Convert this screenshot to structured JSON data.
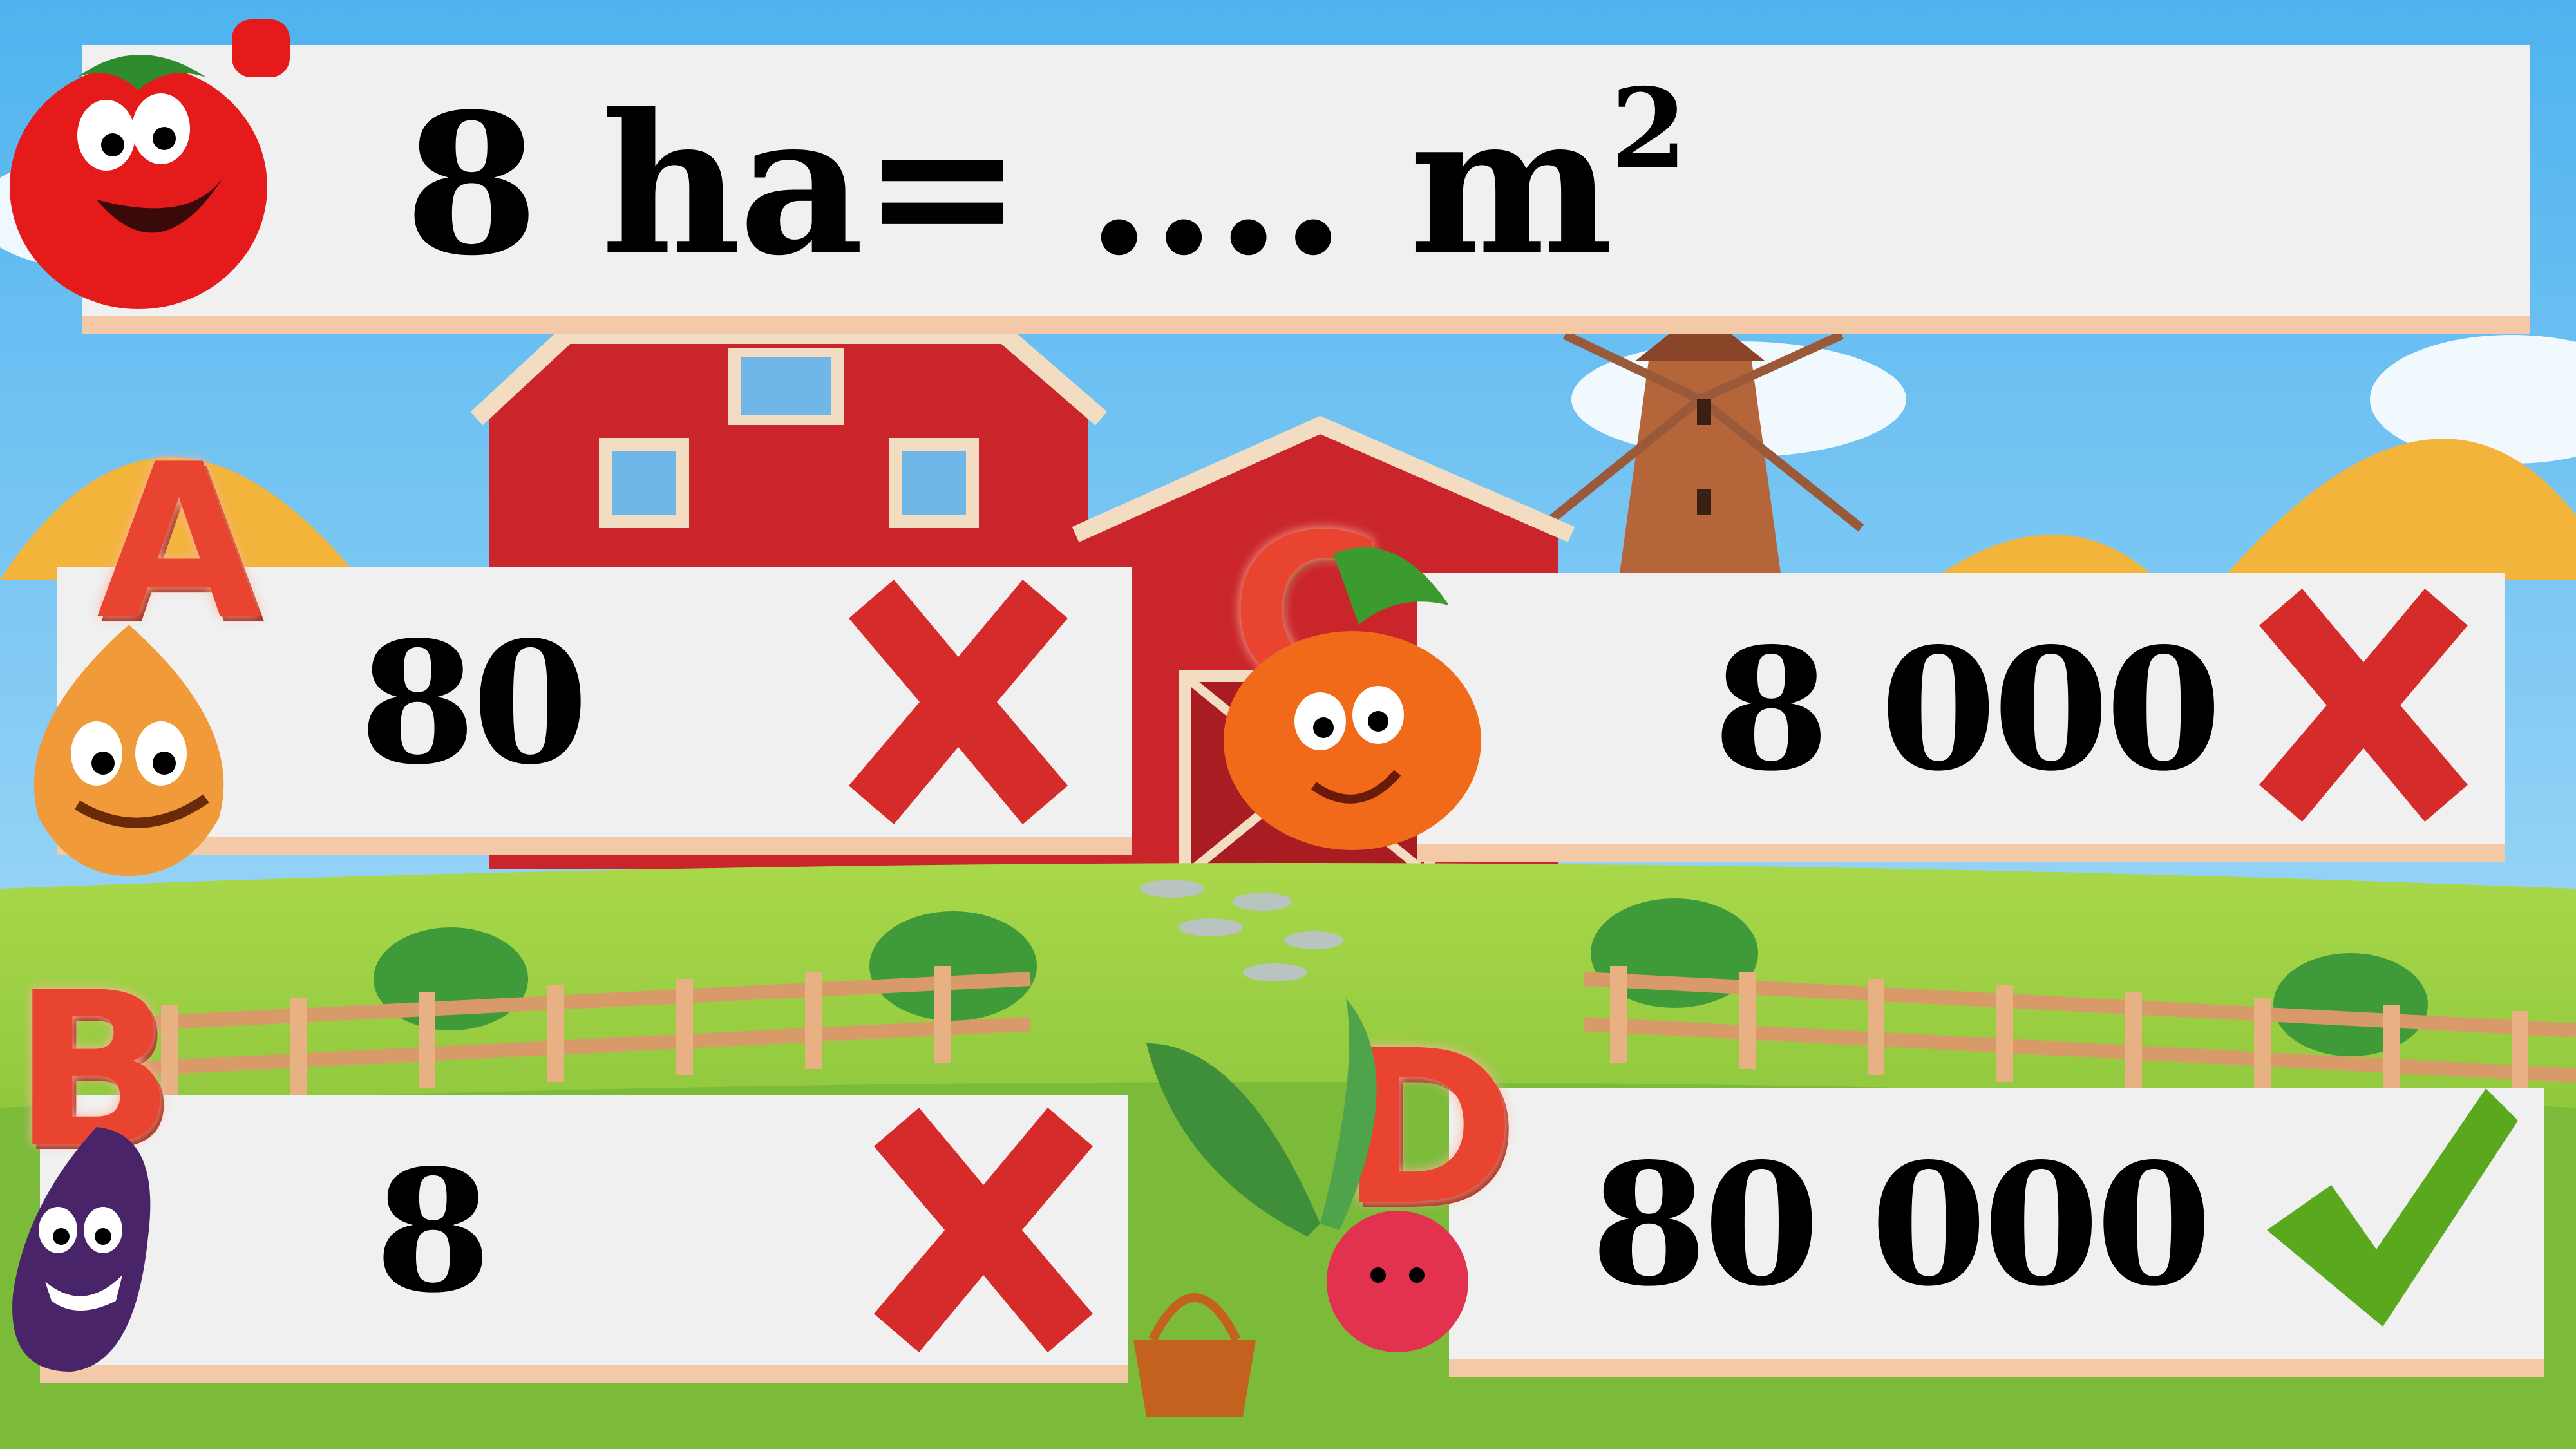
{
  "question": {
    "text": "8 ha= .... m",
    "superscript": "2"
  },
  "answers": [
    {
      "letter": "A",
      "value": "80",
      "status": "wrong",
      "character": "onion-icon"
    },
    {
      "letter": "C",
      "value": "8 000",
      "status": "wrong",
      "character": "pumpkin-icon"
    },
    {
      "letter": "B",
      "value": "8",
      "status": "wrong",
      "character": "eggplant-icon"
    },
    {
      "letter": "D",
      "value": "80 000",
      "status": "correct",
      "character": "radish-icon"
    }
  ],
  "colors": {
    "wrong_mark": "#d62b2b",
    "correct_mark": "#5aa81e",
    "panel": "#f0f0f0",
    "panel_shadow": "#f3c9a8",
    "sky": "#7ec8f2",
    "grass": "#8cc63f"
  }
}
